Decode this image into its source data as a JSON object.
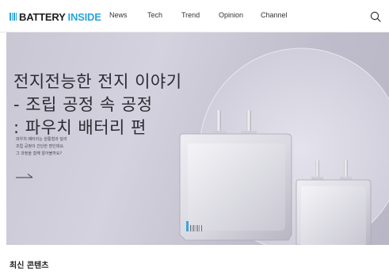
{
  "header": {
    "logo_prefix": "BATTERY",
    "logo_suffix": "INSIDE",
    "nav": [
      "News",
      "Tech",
      "Trend",
      "Opinion",
      "Channel"
    ],
    "search_icon": "search-icon"
  },
  "hero": {
    "title_lines": [
      "전지전능한 전지 이야기",
      "- 조립 공정 속 공정",
      ": 파우치 배터리 편"
    ],
    "desc_lines": [
      "파우치 배터리는 원통형과 달리",
      "조립 공정이 간단한 편인데요.",
      "그 과정을 함께 알아볼까요?"
    ],
    "arrow_icon": "arrow-right-icon"
  },
  "section": {
    "latest_title": "최신 콘텐츠"
  },
  "colors": {
    "accent": "#2aa5d8",
    "hero_background": "#c9c7d3"
  }
}
